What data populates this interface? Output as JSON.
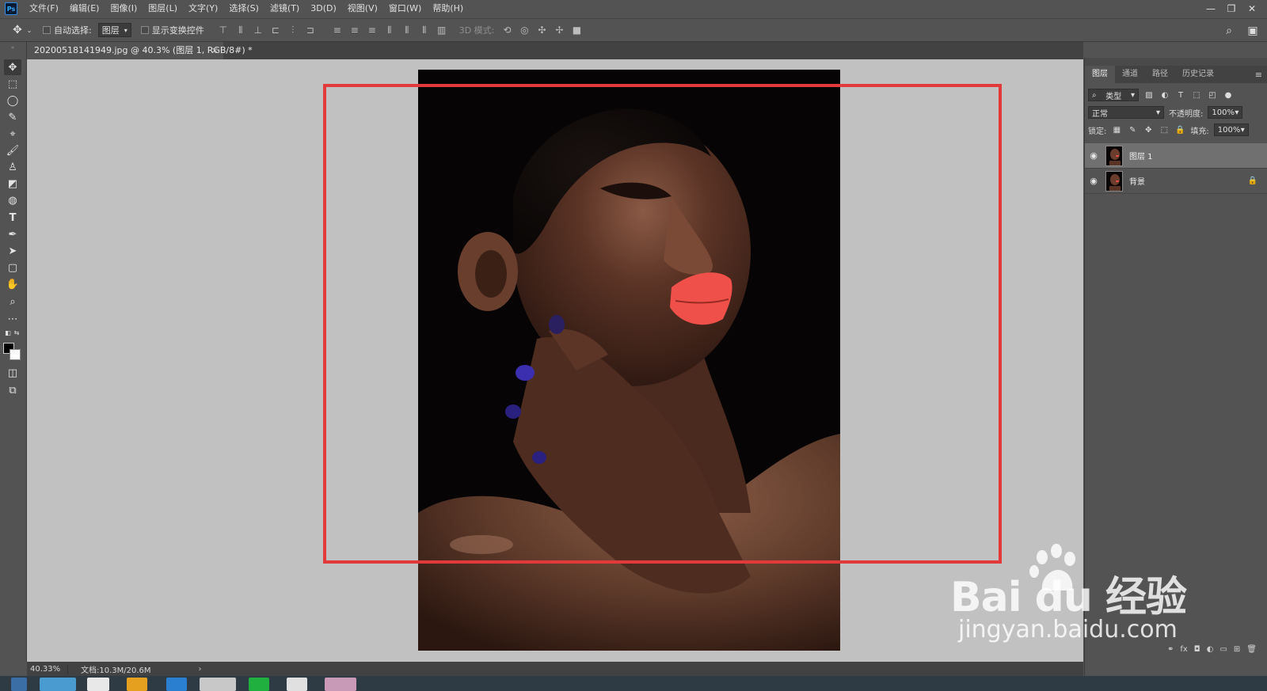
{
  "menubar": {
    "logo": "Ps",
    "items": [
      "文件(F)",
      "编辑(E)",
      "图像(I)",
      "图层(L)",
      "文字(Y)",
      "选择(S)",
      "滤镜(T)",
      "3D(D)",
      "视图(V)",
      "窗口(W)",
      "帮助(H)"
    ]
  },
  "options": {
    "auto_select_label": "自动选择:",
    "auto_select_value": "图层",
    "show_transform_label": "显示变换控件",
    "mode3d_label": "3D 模式:"
  },
  "document": {
    "tab_title": "20200518141949.jpg @ 40.3% (图层 1, RGB/8#) *",
    "close": "×"
  },
  "status": {
    "zoom": "40.33%",
    "doc_size": "文档:10.3M/20.6M",
    "arrow": "›"
  },
  "panel": {
    "tabs": [
      "图层",
      "通道",
      "路径",
      "历史记录"
    ],
    "filter_label": "类型",
    "blend_mode": "正常",
    "opacity_label": "不透明度:",
    "opacity_value": "100%",
    "lock_label": "锁定:",
    "fill_label": "填充:",
    "fill_value": "100%",
    "layers": [
      {
        "name": "图层 1",
        "selected": true,
        "locked": false
      },
      {
        "name": "背景",
        "selected": false,
        "locked": true
      }
    ]
  },
  "watermark": {
    "brand": "Bai du 经验",
    "url": "jingyan.baidu.com"
  },
  "colors": {
    "selection": "#e23a3a",
    "canvas_bg": "#c1c1c1",
    "ui_bg": "#535353",
    "lips": "#f0504a",
    "nails": "#3b2fb0"
  }
}
